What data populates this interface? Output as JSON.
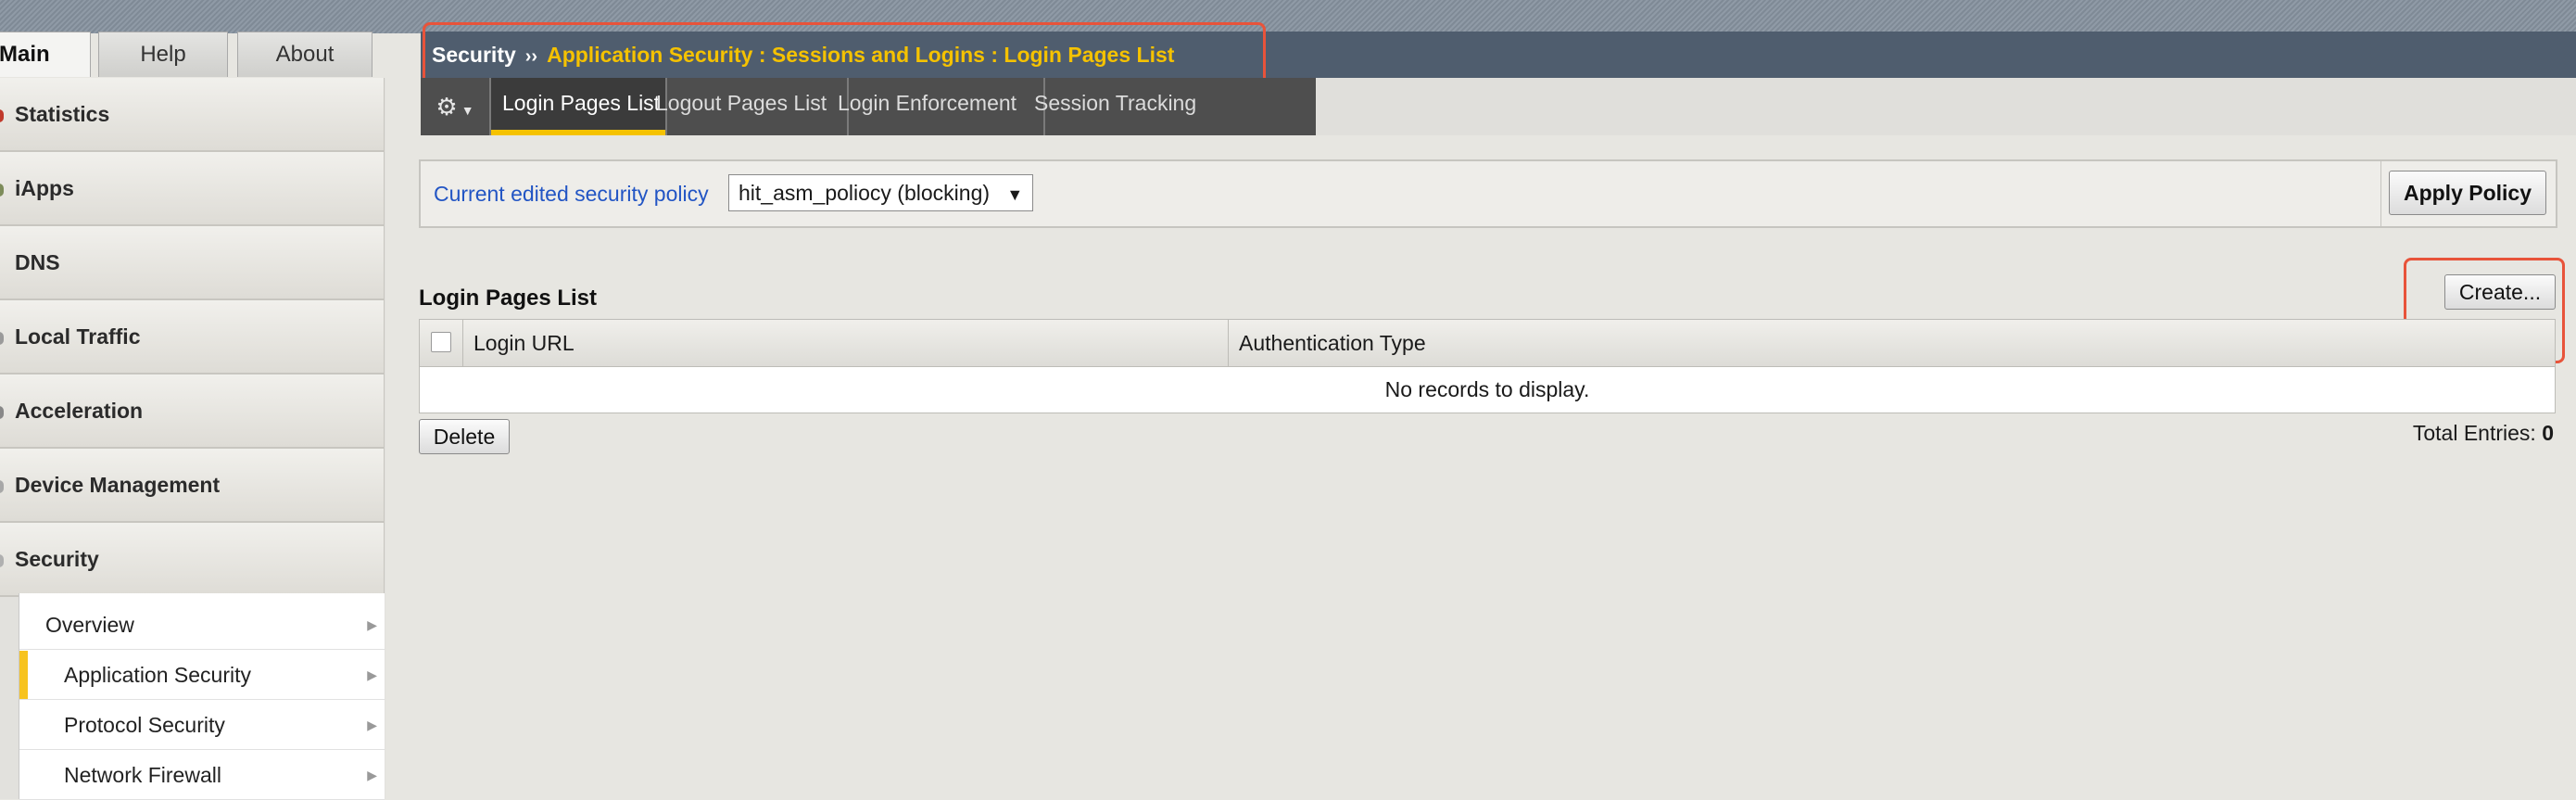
{
  "top_tabs": [
    {
      "label": "Main",
      "active": true
    },
    {
      "label": "Help",
      "active": false
    },
    {
      "label": "About",
      "active": false
    }
  ],
  "nav": {
    "items": [
      {
        "label": "Statistics"
      },
      {
        "label": "iApps"
      },
      {
        "label": "DNS"
      },
      {
        "label": "Local Traffic"
      },
      {
        "label": "Acceleration"
      },
      {
        "label": "Device Management"
      },
      {
        "label": "Security"
      }
    ],
    "security_submenu": [
      {
        "label": "Overview",
        "active": false
      },
      {
        "label": "Application Security",
        "active": true
      },
      {
        "label": "Protocol Security",
        "active": false
      },
      {
        "label": "Network Firewall",
        "active": false
      }
    ]
  },
  "header": {
    "root": "Security",
    "separator": "››",
    "path": "Application Security : Sessions and Logins : Login Pages List"
  },
  "subtabs": [
    {
      "label": "Login Pages List",
      "active": true
    },
    {
      "label": "Logout Pages List",
      "active": false
    },
    {
      "label": "Login Enforcement",
      "active": false
    },
    {
      "label": "Session Tracking",
      "active": false
    }
  ],
  "policy": {
    "label": "Current edited security policy",
    "selected": "hit_asm_poliocy (blocking)",
    "apply_label": "Apply Policy"
  },
  "list": {
    "title": "Login Pages List",
    "create_label": "Create...",
    "columns": [
      "Login URL",
      "Authentication Type"
    ],
    "empty_message": "No records to display.",
    "delete_label": "Delete",
    "total_label": "Total Entries:",
    "total_value": "0"
  },
  "colors": {
    "accent_yellow": "#f5c200",
    "header_bg": "#4f5d6e",
    "highlight_box": "#e8533a",
    "link_blue": "#2255c4"
  }
}
